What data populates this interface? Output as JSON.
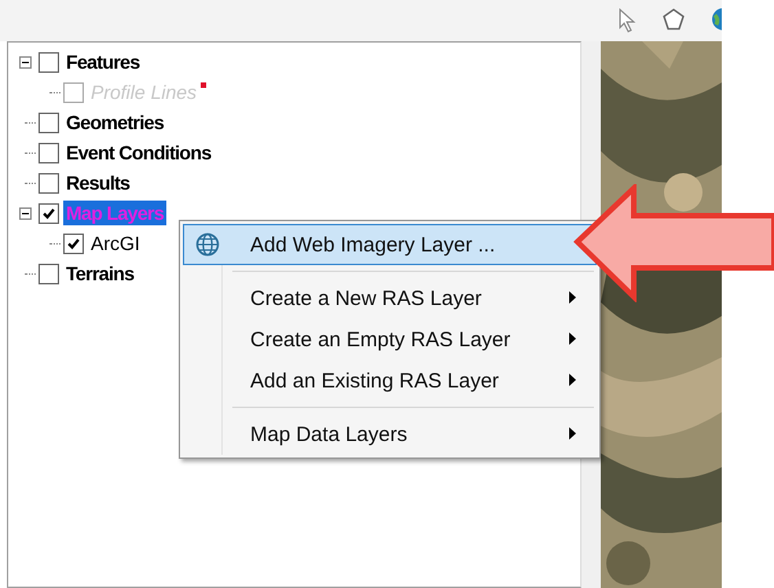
{
  "tree": [
    {
      "label": "Features",
      "checked": false,
      "expanded": true,
      "selected": false,
      "disabled": false,
      "children": [
        {
          "label": "Profile Lines",
          "checked": false,
          "selected": false,
          "disabled": true,
          "marker": true
        }
      ]
    },
    {
      "label": "Geometries",
      "checked": false,
      "selected": false,
      "disabled": false
    },
    {
      "label": "Event Conditions",
      "checked": false,
      "selected": false,
      "disabled": false
    },
    {
      "label": "Results",
      "checked": false,
      "selected": false,
      "disabled": false
    },
    {
      "label": "Map Layers",
      "checked": true,
      "expanded": true,
      "selected": true,
      "disabled": false,
      "children": [
        {
          "label": "ArcGI",
          "checked": true,
          "selected": false,
          "disabled": false
        }
      ]
    },
    {
      "label": "Terrains",
      "checked": false,
      "selected": false,
      "disabled": false
    }
  ],
  "context_menu": {
    "items": [
      {
        "kind": "icon_command",
        "label": "Add Web Imagery Layer ...",
        "selected": true,
        "submenu": false
      },
      {
        "kind": "separator"
      },
      {
        "kind": "command",
        "label": "Create a New RAS Layer",
        "selected": false,
        "submenu": true
      },
      {
        "kind": "command",
        "label": "Create an Empty RAS Layer",
        "selected": false,
        "submenu": true
      },
      {
        "kind": "command",
        "label": "Add an Existing RAS Layer",
        "selected": false,
        "submenu": true
      },
      {
        "kind": "separator"
      },
      {
        "kind": "command",
        "label": "Map Data Layers",
        "selected": false,
        "submenu": true
      }
    ]
  }
}
